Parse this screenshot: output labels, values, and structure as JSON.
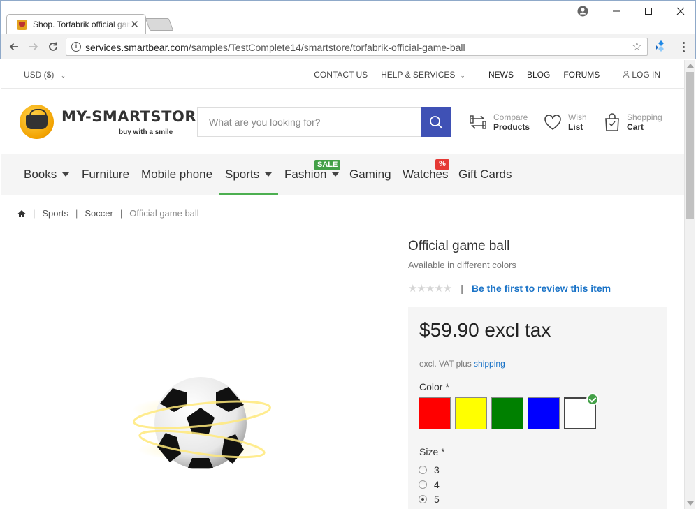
{
  "browser": {
    "tab_title": "Shop. Torfabrik official game ball",
    "url_host": "services.smartbear.com",
    "url_path": "/samples/TestComplete14/smartstore/torfabrik-official-game-ball"
  },
  "util_bar": {
    "currency": "USD ($)",
    "links": [
      "CONTACT US",
      "HELP & SERVICES",
      "NEWS",
      "BLOG",
      "FORUMS",
      "LOG IN"
    ]
  },
  "header": {
    "logo_name": "MY-SMARTSTORE",
    "logo_tagline": "buy with a smile",
    "search_placeholder": "What are you looking for?",
    "compare": {
      "small": "Compare",
      "big": "Products"
    },
    "wish": {
      "small": "Wish",
      "big": "List"
    },
    "cart": {
      "small": "Shopping",
      "big": "Cart"
    }
  },
  "nav": {
    "items": [
      "Books",
      "Furniture",
      "Mobile phone",
      "Sports",
      "Fashion",
      "Gaming",
      "Watches",
      "Gift Cards"
    ],
    "active": "Sports",
    "badge_sale": "SALE",
    "badge_percent": "%"
  },
  "breadcrumb": {
    "items": [
      "Sports",
      "Soccer",
      "Official game ball"
    ]
  },
  "product": {
    "title": "Official game ball",
    "subtitle": "Available in different colors",
    "rating_stars": 0,
    "review_link": "Be the first to review this item",
    "price": "$59.90 excl tax",
    "tax_note": "excl. VAT plus",
    "shipping_link": "shipping",
    "color_label": "Color *",
    "colors": [
      "#ff0000",
      "#ffff00",
      "#008000",
      "#0000ff",
      "#ffffff"
    ],
    "selected_color": "#ffffff",
    "size_label": "Size *",
    "sizes": [
      "3",
      "4",
      "5"
    ],
    "selected_size": "5"
  }
}
